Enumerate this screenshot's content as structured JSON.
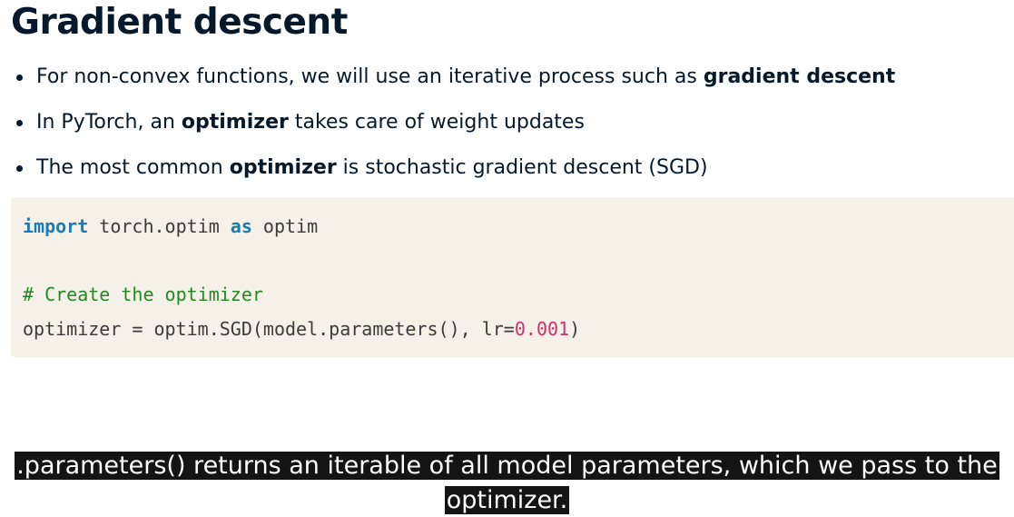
{
  "slide": {
    "title": "Gradient descent"
  },
  "bullets": [
    {
      "pre": "For non-convex functions, we will use an iterative process such as ",
      "bold": "gradient descent",
      "post": ""
    },
    {
      "pre": "In PyTorch, an ",
      "bold": "optimizer",
      "post": " takes care of weight updates"
    },
    {
      "pre": "The most common ",
      "bold": "optimizer",
      "post": " is stochastic gradient descent (SGD)"
    }
  ],
  "code": {
    "line1": {
      "kw1": "import",
      "mid": " torch.optim ",
      "kw2": "as",
      "rest": " optim"
    },
    "comment": "# Create the optimizer",
    "line3": {
      "pre": "optimizer = optim.SGD(model.parameters(), lr=",
      "num": "0.001",
      "post": ")"
    }
  },
  "caption": {
    "line1": ".parameters() returns an iterable of all model parameters, which we pass to the",
    "line2": "optimizer."
  },
  "colors": {
    "title": "#05192d",
    "code_background": "#f5f0e8",
    "keyword": "#1a7bb5",
    "comment": "#1f8a1f",
    "number": "#d0306a",
    "caption_background": "#141414",
    "caption_text": "#ffffff"
  }
}
